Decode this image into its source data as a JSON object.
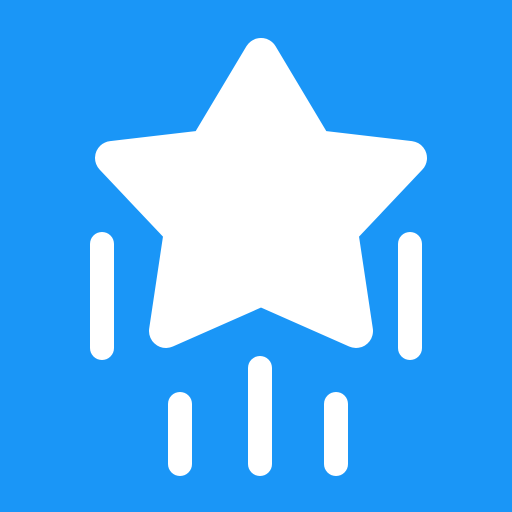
{
  "icon": {
    "name": "shooting-star-icon",
    "background_color": "#1A96F7",
    "foreground_color": "#FFFFFF"
  }
}
